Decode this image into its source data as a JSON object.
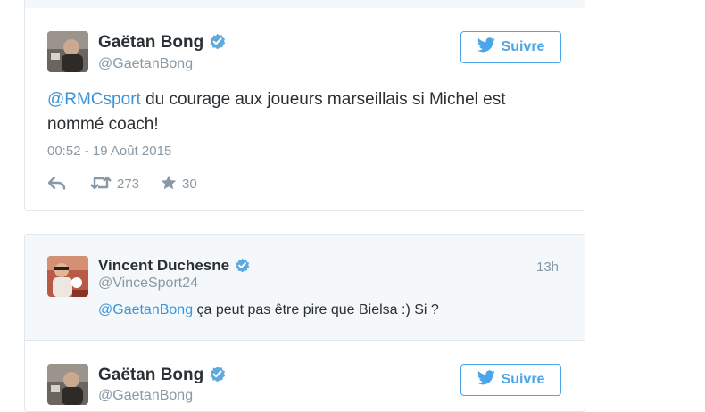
{
  "tweet": {
    "author_name": "Gaëtan Bong",
    "author_handle": "@GaetanBong",
    "follow_label": "Suivre",
    "mention": "@RMCsport",
    "text_rest": " du courage aux joueurs marseillais si Michel est nommé coach!",
    "timestamp": "00:52 - 19 Août 2015",
    "retweet_count": "273",
    "like_count": "30"
  },
  "reply": {
    "author_name": "Vincent Duchesne",
    "author_handle": "@VinceSport24",
    "time_ago": "13h",
    "mention": "@GaetanBong",
    "text_rest": " ça peut pas être pire que Bielsa :) Si ?"
  },
  "nested_tweet": {
    "author_name": "Gaëtan Bong",
    "author_handle": "@GaetanBong",
    "follow_label": "Suivre"
  },
  "colors": {
    "link": "#3b94d9",
    "verified": "#5ea9dd",
    "meta": "#8899a6",
    "follow": "#4aa6e8"
  },
  "icons": [
    "verified-badge-icon",
    "twitter-bird-icon",
    "reply-icon",
    "retweet-icon",
    "star-icon"
  ]
}
